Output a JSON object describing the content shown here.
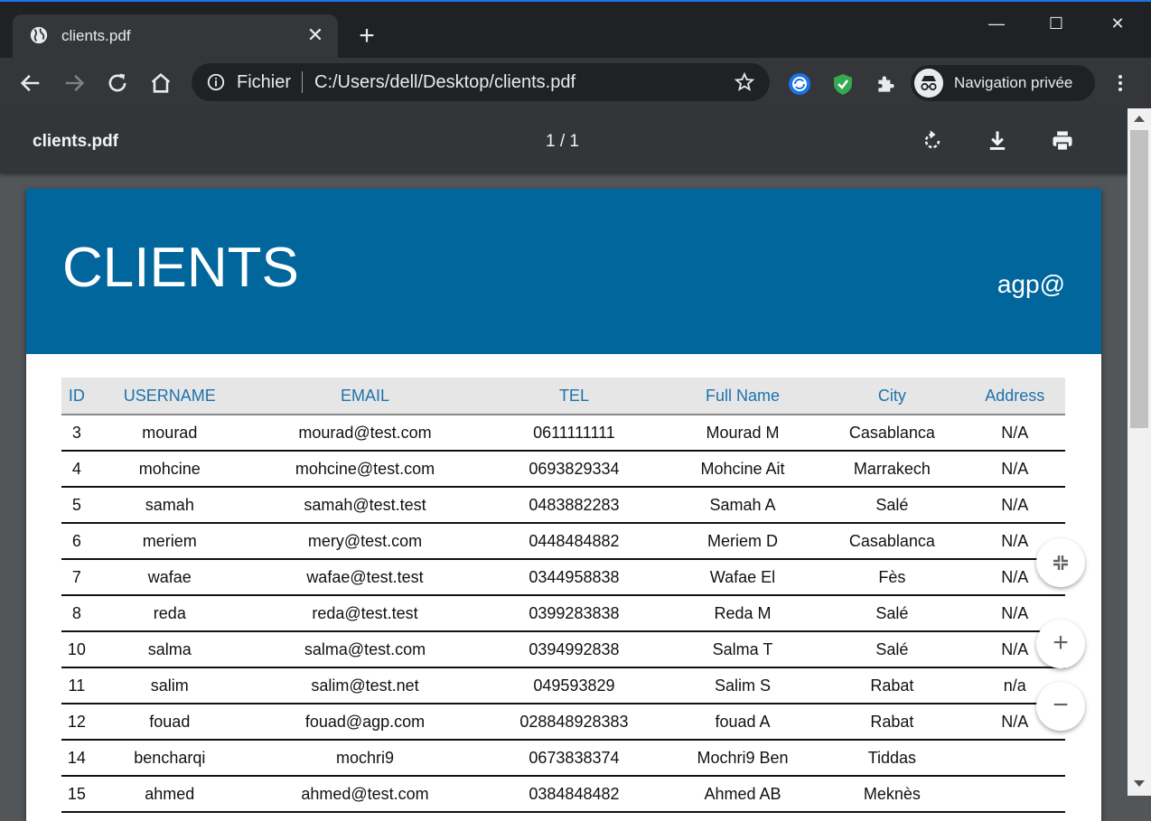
{
  "tab": {
    "title": "clients.pdf",
    "new_tab": "+"
  },
  "window": {
    "minimize": "—",
    "maximize": "☐",
    "close": "✕"
  },
  "toolbar": {
    "scheme": "Fichier",
    "url": "C:/Users/dell/Desktop/clients.pdf",
    "incognito_label": "Navigation privée"
  },
  "pdf": {
    "filename": "clients.pdf",
    "page_indicator": "1 / 1"
  },
  "document": {
    "title": "CLIENTS",
    "brand": "agp@",
    "columns": [
      "ID",
      "USERNAME",
      "EMAIL",
      "TEL",
      "Full Name",
      "City",
      "Address"
    ],
    "rows": [
      [
        "3",
        "mourad",
        "mourad@test.com",
        "0611111111",
        "Mourad M",
        "Casablanca",
        "N/A"
      ],
      [
        "4",
        "mohcine",
        "mohcine@test.com",
        "0693829334",
        "Mohcine Ait",
        "Marrakech",
        "N/A"
      ],
      [
        "5",
        "samah",
        "samah@test.test",
        "0483882283",
        "Samah A",
        "Salé",
        "N/A"
      ],
      [
        "6",
        "meriem",
        "mery@test.com",
        "0448484882",
        "Meriem D",
        "Casablanca",
        "N/A"
      ],
      [
        "7",
        "wafae",
        "wafae@test.test",
        "0344958838",
        "Wafae El",
        "Fès",
        "N/A"
      ],
      [
        "8",
        "reda",
        "reda@test.test",
        "0399283838",
        "Reda M",
        "Salé",
        "N/A"
      ],
      [
        "10",
        "salma",
        "salma@test.com",
        "0394992838",
        "Salma T",
        "Salé",
        "N/A"
      ],
      [
        "11",
        "salim",
        "salim@test.net",
        "049593829",
        "Salim S",
        "Rabat",
        "n/a"
      ],
      [
        "12",
        "fouad",
        "fouad@agp.com",
        "028848928383",
        "fouad A",
        "Rabat",
        "N/A"
      ],
      [
        "14",
        "bencharqi",
        "mochri9",
        "0673838374",
        "Mochri9 Ben",
        "Tiddas",
        ""
      ],
      [
        "15",
        "ahmed",
        "ahmed@test.com",
        "0384848482",
        "Ahmed AB",
        "Meknès",
        ""
      ]
    ]
  },
  "zoom": {
    "fit": "⤡",
    "in": "+",
    "out": "−"
  }
}
